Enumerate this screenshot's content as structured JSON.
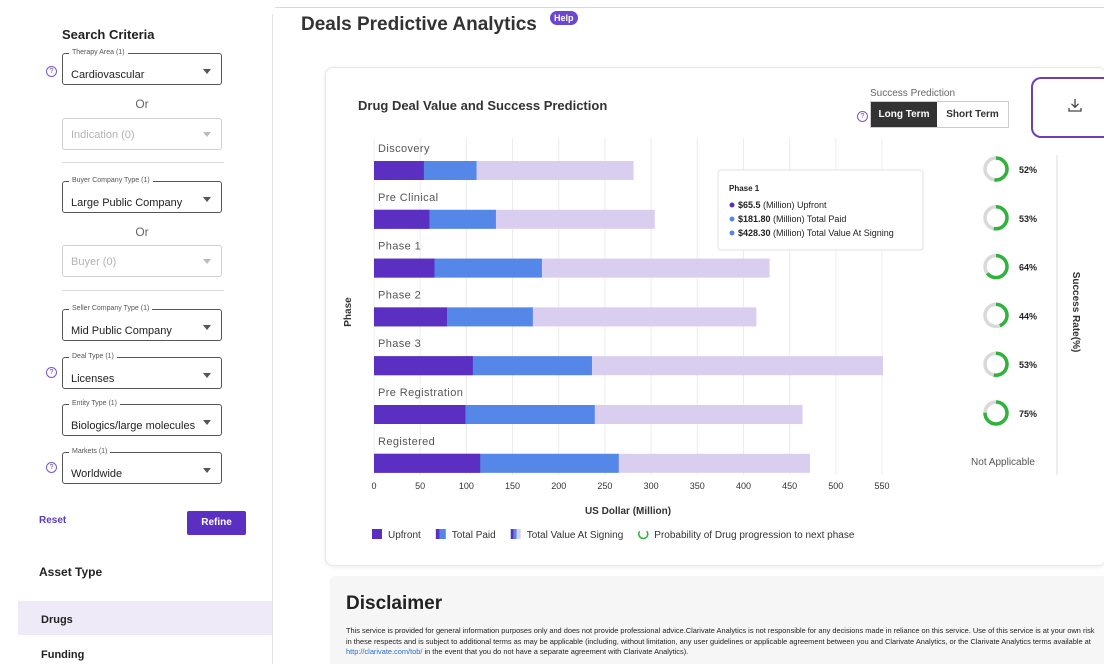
{
  "sidebar": {
    "title": "Search Criteria",
    "fields": {
      "therapy_area": {
        "legend": "Therapy Area (1)",
        "value": "Cardiovascular"
      },
      "indication": {
        "value": "Indication (0)"
      },
      "buyer_company_type": {
        "legend": "Buyer Company Type (1)",
        "value": "Large Public Company"
      },
      "buyer": {
        "value": "Buyer (0)"
      },
      "seller_company_type": {
        "legend": "Seller Company Type (1)",
        "value": "Mid Public Company"
      },
      "deal_type": {
        "legend": "Deal Type (1)",
        "value": "Licenses"
      },
      "entity_type": {
        "legend": "Entity Type (1)",
        "value": "Biologics/large molecules"
      },
      "markets": {
        "legend": "Markets (1)",
        "value": "Worldwide"
      }
    },
    "or_label": "Or",
    "help_glyph": "?",
    "reset_label": "Reset",
    "refine_label": "Refine",
    "asset_type_title": "Asset Type",
    "nav": [
      {
        "label": "Drugs",
        "active": true
      },
      {
        "label": "Funding",
        "active": false
      }
    ]
  },
  "main": {
    "title": "Deals Predictive Analytics",
    "help_badge": "Help",
    "chart_title": "Drug Deal Value and Success Prediction",
    "success_prediction_label": "Success Prediction",
    "toggle": {
      "long_term": "Long Term",
      "short_term": "Short Term",
      "selected": "Long Term"
    },
    "download_icon": "download-icon"
  },
  "colors": {
    "upfront": "#5b2fc2",
    "total_paid": "#5587e8",
    "total_value": "#d9cdf0",
    "success_ring": "#2fb33a",
    "ring_track": "#d9d9d9",
    "accent": "#6b46c1"
  },
  "chart_data": {
    "type": "bar",
    "orientation": "horizontal",
    "ylabel": "Phase",
    "xlabel": "US Dollar (Million)",
    "right_axis_label": "Success Rate(%)",
    "xlim": [
      0,
      550
    ],
    "xticks": [
      0,
      50,
      100,
      150,
      200,
      250,
      300,
      350,
      400,
      450,
      500,
      550
    ],
    "grid": true,
    "categories": [
      "Discovery",
      "Pre Clinical",
      "Phase 1",
      "Phase 2",
      "Phase 3",
      "Pre Registration",
      "Registered"
    ],
    "series": [
      {
        "name": "Upfront",
        "values": [
          54,
          60,
          65.5,
          79,
          107,
          99,
          115
        ]
      },
      {
        "name": "Total Paid",
        "values": [
          111,
          132,
          181.8,
          172,
          236,
          239,
          265
        ]
      },
      {
        "name": "Total Value At Signing",
        "values": [
          281,
          304,
          428.3,
          414,
          551,
          464,
          472
        ]
      }
    ],
    "success_rate": [
      "52%",
      "53%",
      "64%",
      "44%",
      "53%",
      "75%",
      "Not Applicable"
    ],
    "success_rate_values": [
      52,
      53,
      64,
      44,
      53,
      75,
      null
    ],
    "legend": [
      "Upfront",
      "Total Paid",
      "Total Value At Signing",
      "Probability of Drug progression to next phase"
    ],
    "legend_position": "bottom",
    "tooltip": {
      "title": "Phase 1",
      "lines": [
        {
          "value": "$65.5",
          "text": " (Million) Upfront"
        },
        {
          "value": "$181.80",
          "text": " (Million) Total Paid"
        },
        {
          "value": "$428.30",
          "text": " (Million) Total Value At Signing"
        }
      ]
    }
  },
  "disclaimer": {
    "title": "Disclaimer",
    "text_1": "This service is provided for general information purposes only and does not provide professional advice.Clarivate Analytics is not responsible for any decisions made in reliance on this service. Use of this service is at your own risk in these respects and is subject to additional terms as may be applicable (including, without limitation, any user guidelines or applicable agreement between you and Clarivate Analytics, or the Clarivate Analytics terms available at ",
    "link": "http://clarivate.com/tob/",
    "text_2": " in the event that you do not have a separate agreement with Clarivate Analytics)."
  }
}
